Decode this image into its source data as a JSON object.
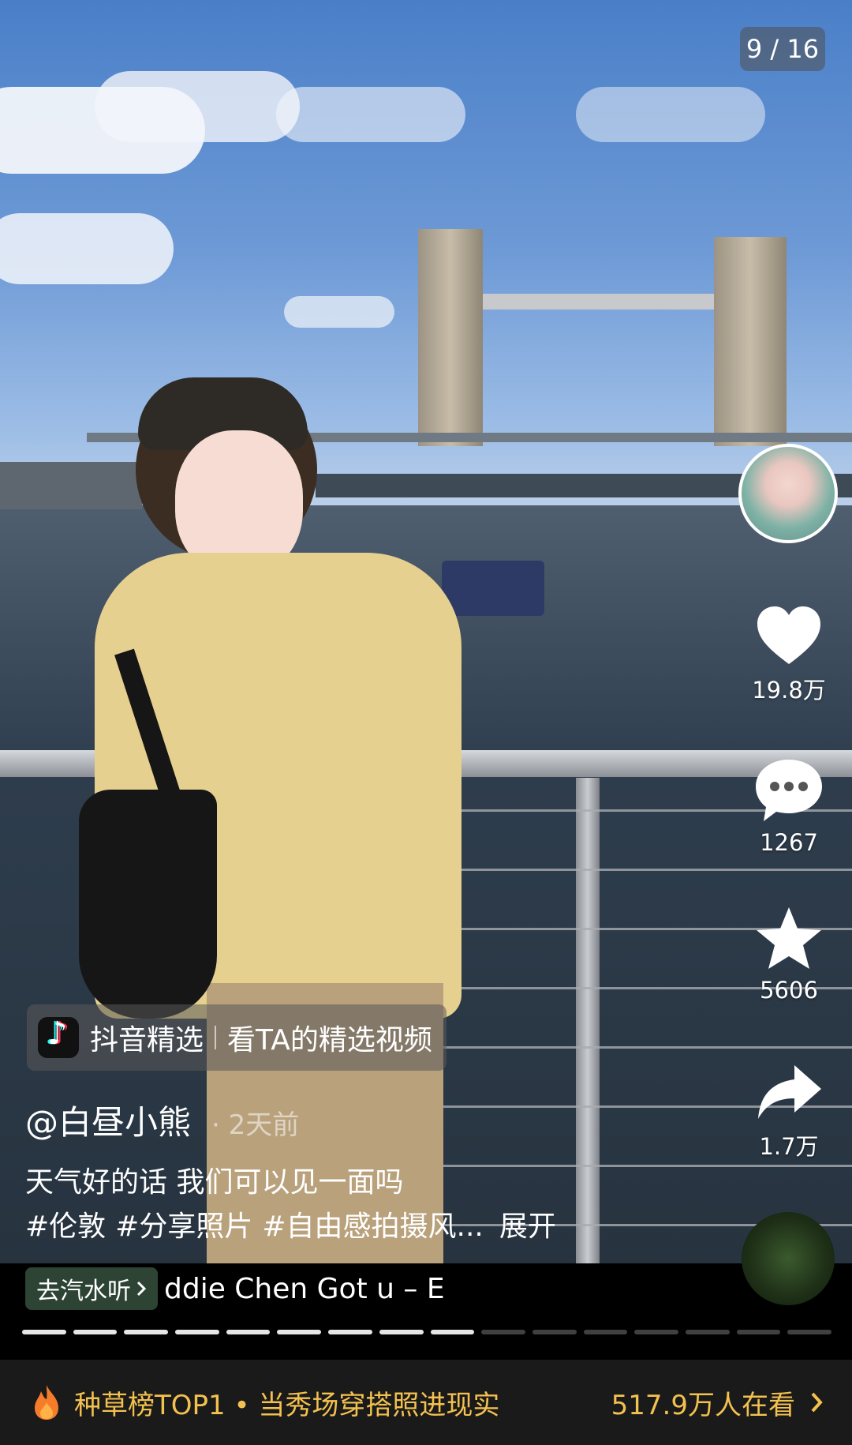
{
  "page_counter": "9 / 16",
  "actions": {
    "likes": "19.8万",
    "comments": "1267",
    "favorites": "5606",
    "shares": "1.7万"
  },
  "douyin_chip": {
    "brand": "抖音精选",
    "link": "看TA的精选视频"
  },
  "post": {
    "author": "@白昼小熊",
    "time": "· 2天前",
    "caption": "天气好的话 我们可以见一面吗",
    "hashtags": [
      "#伦敦",
      "#分享照片",
      "#自由感拍摄风..."
    ],
    "expand": "展开"
  },
  "music": {
    "chip": "去汽水听",
    "text": "ddie Chen    Got u – E"
  },
  "progress": {
    "total": 16,
    "current": 9
  },
  "banner": {
    "title": "种草榜TOP1 • 当秀场穿搭照进现实",
    "count": "517.9万人在看"
  },
  "colors": {
    "accent_gold": "#f3c14f",
    "banner_bg": "#1a1a1a"
  },
  "icons": [
    "heart-icon",
    "comment-icon",
    "star-icon",
    "share-icon",
    "flame-icon",
    "chevron-right-icon",
    "tiktok-logo-icon"
  ]
}
